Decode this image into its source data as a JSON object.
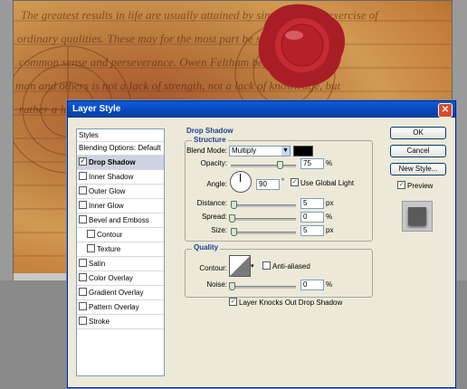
{
  "dialog": {
    "title": "Layer Style",
    "close_symbol": "✕"
  },
  "styles_list": {
    "header": "Styles",
    "blending": "Blending Options: Default",
    "items": [
      {
        "label": "Drop Shadow",
        "checked": true,
        "selected": true
      },
      {
        "label": "Inner Shadow",
        "checked": false
      },
      {
        "label": "Outer Glow",
        "checked": false
      },
      {
        "label": "Inner Glow",
        "checked": false
      },
      {
        "label": "Bevel and Emboss",
        "checked": false
      },
      {
        "label": "Contour",
        "checked": false,
        "indent": true
      },
      {
        "label": "Texture",
        "checked": false,
        "indent": true
      },
      {
        "label": "Satin",
        "checked": false
      },
      {
        "label": "Color Overlay",
        "checked": false
      },
      {
        "label": "Gradient Overlay",
        "checked": false
      },
      {
        "label": "Pattern Overlay",
        "checked": false
      },
      {
        "label": "Stroke",
        "checked": false
      }
    ]
  },
  "drop_shadow": {
    "heading": "Drop Shadow",
    "structure_heading": "Structure",
    "blend_mode_label": "Blend Mode:",
    "blend_mode_value": "Multiply",
    "shadow_color": "#000000",
    "opacity_label": "Opacity:",
    "opacity_value": "75",
    "opacity_unit": "%",
    "opacity_level": 0.75,
    "angle_label": "Angle:",
    "angle_value": "90",
    "angle_unit": "°",
    "global_light_label": "Use Global Light",
    "global_light_checked": true,
    "distance_label": "Distance:",
    "distance_value": "5",
    "distance_unit": "px",
    "spread_label": "Spread:",
    "spread_value": "0",
    "spread_unit": "%",
    "size_label": "Size:",
    "size_value": "5",
    "size_unit": "px",
    "quality_heading": "Quality",
    "contour_label": "Contour:",
    "anti_aliased_label": "Anti-aliased",
    "noise_label": "Noise:",
    "noise_value": "0",
    "noise_unit": "%",
    "knockout_label": "Layer Knocks Out Drop Shadow",
    "knockout_checked": true
  },
  "buttons": {
    "ok": "OK",
    "cancel": "Cancel",
    "new_style": "New Style...",
    "preview": "Preview",
    "preview_checked": true
  },
  "background_text": {
    "line1": "The greatest results in life are usually attained by simple and the exercise of",
    "line2": "ordinary qualities. These may for the most part be summed up in",
    "line3": "common sense and perseverance. Owen Feltham between a",
    "line4": "man and others is not a lack of strength, not a lack of knowledge, but",
    "line5": "rather a lack of will."
  },
  "colors": {
    "accent": "#0a246a",
    "titlebar": "#0848b8",
    "seal": "#b0222a"
  }
}
